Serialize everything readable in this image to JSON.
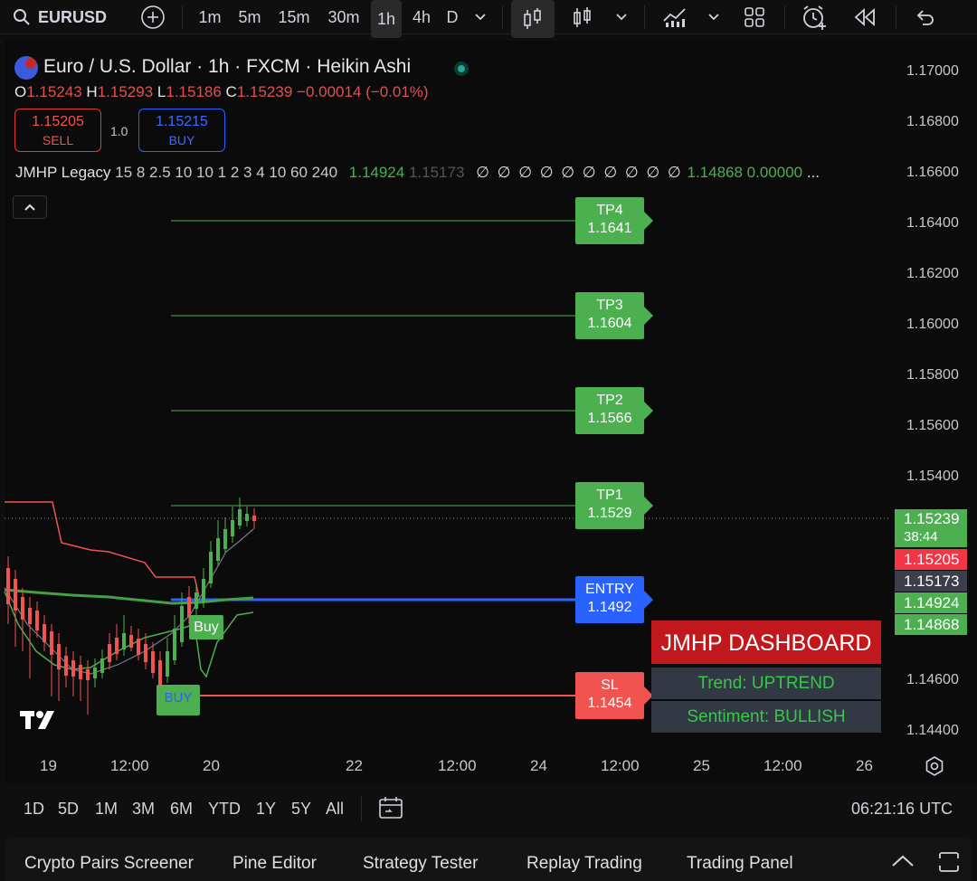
{
  "toolbar": {
    "symbol": "EURUSD",
    "intervals": [
      "1m",
      "5m",
      "15m",
      "30m",
      "1h",
      "4h",
      "D"
    ],
    "active_interval": "1h"
  },
  "legend": {
    "title": "Euro / U.S. Dollar · 1h · FXCM · Heikin Ashi",
    "o_label": "O",
    "o": "1.15243",
    "h_label": "H",
    "h": "1.15293",
    "l_label": "L",
    "l": "1.15186",
    "c_label": "C",
    "c": "1.15239",
    "change": "−0.00014 (−0.01%)"
  },
  "trade": {
    "sell_price": "1.15205",
    "sell_label": "SELL",
    "qty": "1.0",
    "buy_price": "1.15215",
    "buy_label": "BUY"
  },
  "indicator": {
    "name": "JMHP Legacy",
    "params": "15 8 2.5 10 10 1 2 3 4 10 60 240",
    "v1": "1.14924",
    "v2": "1.15173",
    "nulls": "∅ ∅ ∅ ∅ ∅ ∅ ∅ ∅ ∅ ∅",
    "v3": "1.14868",
    "v4": "0.00000",
    "more": "..."
  },
  "price_labels": [
    "1.17000",
    "1.16800",
    "1.16600",
    "1.16400",
    "1.16200",
    "1.16000",
    "1.15800",
    "1.15600",
    "1.15400",
    "1.14600",
    "1.14400"
  ],
  "levels": {
    "tp4_label": "TP4",
    "tp4": "1.1641",
    "tp3_label": "TP3",
    "tp3": "1.1604",
    "tp2_label": "TP2",
    "tp2": "1.1566",
    "tp1_label": "TP1",
    "tp1": "1.1529",
    "entry_label": "ENTRY",
    "entry": "1.1492",
    "sl_label": "SL",
    "sl": "1.1454"
  },
  "axis_tags": {
    "last": "1.15239",
    "countdown": "38:44",
    "bid": "1.15205",
    "gray": "1.15173",
    "ind1": "1.14924",
    "ind2": "1.14868"
  },
  "signals": {
    "buy_green": "Buy",
    "buy_blue": "BUY"
  },
  "dashboard": {
    "title": "JMHP DASHBOARD",
    "trend": "Trend: UPTREND",
    "sentiment": "Sentiment: BULLISH"
  },
  "time_labels": [
    "19",
    "12:00",
    "20",
    "22",
    "12:00",
    "24",
    "12:00",
    "25",
    "12:00",
    "26"
  ],
  "ranges": [
    "1D",
    "5D",
    "1M",
    "3M",
    "6M",
    "YTD",
    "1Y",
    "5Y",
    "All"
  ],
  "clock": "06:21:16 UTC",
  "bottom_tabs": [
    "Crypto Pairs Screener",
    "Pine Editor",
    "Strategy Tester",
    "Replay Trading",
    "Trading Panel"
  ],
  "colors": {
    "green": "#4caf50",
    "red": "#f05350",
    "blue": "#2962ff",
    "dash_red": "#c0181c"
  }
}
